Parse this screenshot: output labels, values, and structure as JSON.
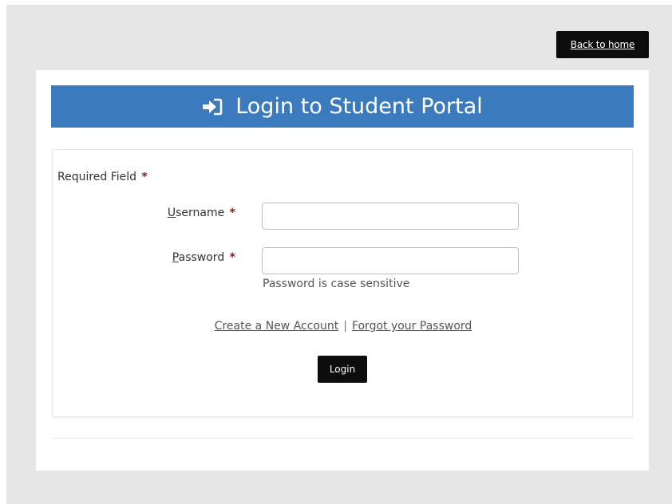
{
  "header": {
    "back_label": "Back to home"
  },
  "banner": {
    "icon": "sign-in-icon",
    "title": "Login to Student Portal"
  },
  "form": {
    "required_note": "Required Field",
    "required_marker": "*",
    "username": {
      "label_first": "U",
      "label_rest": "sername",
      "value": "",
      "placeholder": ""
    },
    "password": {
      "label_first": "P",
      "label_rest": "assword",
      "value": "",
      "placeholder": "",
      "hint": "Password is case sensitive"
    },
    "links": {
      "create_account": "Create a New Account",
      "separator": "|",
      "forgot_password": "Forgot your Password"
    },
    "login_label": "Login"
  },
  "colors": {
    "banner": "#3b7bbd",
    "button": "#0c0c0c",
    "required_star": "#8b1a1a",
    "page_bg": "#e6e6e6"
  }
}
